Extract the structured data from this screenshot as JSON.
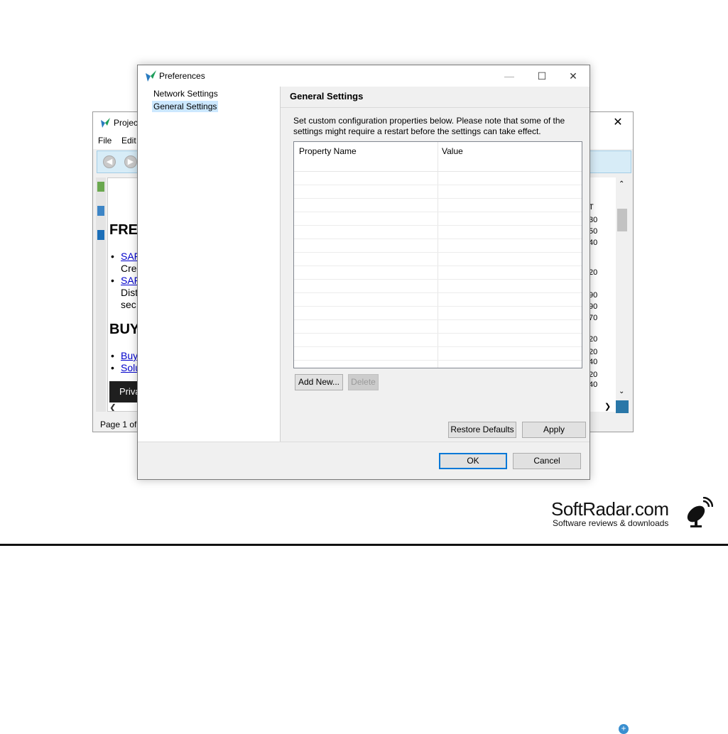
{
  "background_window": {
    "title": "Projec",
    "menu": [
      "File",
      "Edit"
    ],
    "content": {
      "heading1": "FRE",
      "links": [
        {
          "link": "SAF",
          "text": "Cre"
        },
        {
          "link": "SAF",
          "text": "Dist",
          "text2": "sec"
        }
      ],
      "heading2": "BUY",
      "links2": [
        "Buy",
        "Solu"
      ],
      "privacy_bar": "Priva"
    },
    "status": "Page 1 of",
    "right_numbers": [
      "T",
      "30",
      "50",
      "40",
      "20",
      "90",
      "90",
      "70",
      "20",
      "20",
      "40",
      "20",
      "40"
    ]
  },
  "dialog": {
    "title": "Preferences",
    "tree": [
      {
        "label": "Network Settings",
        "selected": false
      },
      {
        "label": "General Settings",
        "selected": true
      }
    ],
    "panel_title": "General Settings",
    "description": "Set custom configuration properties below.  Please note that some of the settings might require a restart before the settings can take effect.",
    "table": {
      "columns": [
        "Property Name",
        "Value"
      ],
      "rows": []
    },
    "add_new_label": "Add New...",
    "delete_label": "Delete",
    "restore_defaults_label": "Restore Defaults",
    "apply_label": "Apply",
    "ok_label": "OK",
    "cancel_label": "Cancel"
  },
  "watermark": {
    "main": "SoftRadar.com",
    "sub": "Software reviews & downloads"
  }
}
